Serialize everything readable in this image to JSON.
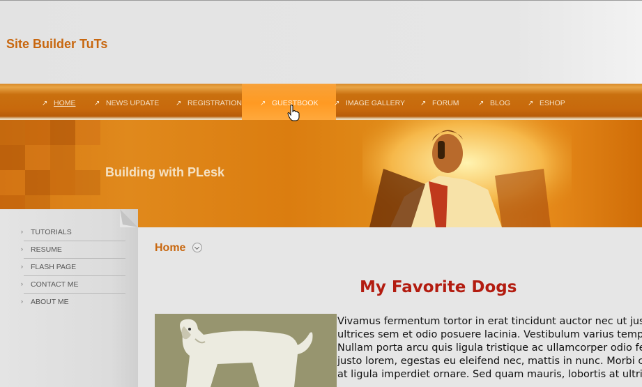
{
  "header": {
    "site_title": "Site Builder TuTs"
  },
  "nav": {
    "items": [
      {
        "label": "HOME",
        "active": true
      },
      {
        "label": "NEWS UPDATE"
      },
      {
        "label": "REGISTRATION"
      },
      {
        "label": "GUESTBOOK",
        "hovered": true
      },
      {
        "label": "IMAGE GALLERY"
      },
      {
        "label": "FORUM"
      },
      {
        "label": "BLOG"
      },
      {
        "label": "ESHOP"
      }
    ]
  },
  "banner": {
    "title": "Building with PLesk"
  },
  "sidebar": {
    "items": [
      {
        "label": "TUTORIALS"
      },
      {
        "label": "RESUME"
      },
      {
        "label": "FLASH PAGE"
      },
      {
        "label": "CONTACT ME"
      },
      {
        "label": "ABOUT ME"
      }
    ]
  },
  "main": {
    "breadcrumb": "Home",
    "heading": "My Favorite Dogs",
    "paragraph_lines": [
      "Vivamus fermentum tortor in erat tincidunt auctor nec ut justo",
      "ultrices sem et odio posuere lacinia. Vestibulum varius tempor",
      "Nullam porta arcu quis ligula tristique ac ullamcorper odio feu",
      "justo lorem, egestas eu eleifend nec, mattis in nunc. Morbi co",
      "at ligula imperdiet ornare. Sed quam mauris, lobortis at ultrice"
    ]
  },
  "colors": {
    "accent": "#c8670f",
    "heading": "#b31c10",
    "nav_bg": "#c8690c",
    "nav_hover": "#ff9a22"
  }
}
